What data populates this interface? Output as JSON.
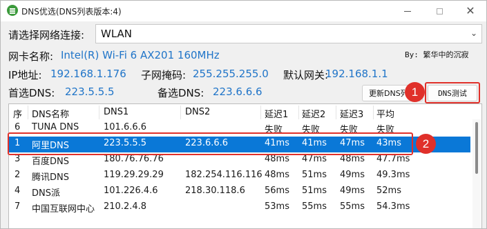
{
  "window": {
    "title": "DNS优选(DNS列表版本:4)",
    "minimize_glyph": "",
    "maximize_glyph": "",
    "close_glyph": "✕"
  },
  "network": {
    "label": "请选择网络连接:",
    "selected": "WLAN"
  },
  "adapter": {
    "label": "网卡名称:",
    "value": "Intel(R) Wi-Fi 6 AX201 160MHz"
  },
  "author": "By: 繁华中的沉寂",
  "ip": {
    "ip_label": "IP地址:",
    "ip_value": "192.168.1.176",
    "mask_label": "子网掩码:",
    "mask_value": "255.255.255.0",
    "gateway_label": "默认网关:",
    "gateway_value": "192.168.1.1"
  },
  "dns": {
    "primary_label": "首选DNS:",
    "primary_value": "223.5.5.5",
    "secondary_label": "备选DNS:",
    "secondary_value": "223.6.6.6"
  },
  "buttons": {
    "update": "更新DNS列表",
    "test": "DNS测试"
  },
  "annotations": {
    "badge_1": "1",
    "badge_2": "2"
  },
  "table": {
    "columns": [
      "序",
      "DNS名称",
      "DNS1",
      "DNS2",
      "延迟1",
      "延迟2",
      "延迟3",
      "平均"
    ],
    "rows": [
      [
        "6",
        "TUNA DNS",
        "101.6.6.6",
        "",
        "失败",
        "失败",
        "失败",
        "失败"
      ],
      [
        "1",
        "阿里DNS",
        "223.5.5.5",
        "223.6.6.6",
        "41ms",
        "41ms",
        "47ms",
        "43ms"
      ],
      [
        "3",
        "百度DNS",
        "180.76.76.76",
        "",
        "48ms",
        "47ms",
        "48ms",
        "47.7ms"
      ],
      [
        "2",
        "腾讯DNS",
        "119.29.29.29",
        "182.254.116.116",
        "48ms",
        "51ms",
        "49ms",
        "49.3ms"
      ],
      [
        "4",
        "DNS派",
        "101.226.4.6",
        "218.30.118.6",
        "56ms",
        "51ms",
        "49ms",
        "52ms"
      ],
      [
        "7",
        "中国互联网中心",
        "210.2.4.8",
        "",
        "53ms",
        "55ms",
        "55ms",
        "54.3ms"
      ]
    ]
  },
  "colors": {
    "accent": "#1f74c8",
    "selection": "#0a78d7",
    "annotation": "#e0302a"
  }
}
